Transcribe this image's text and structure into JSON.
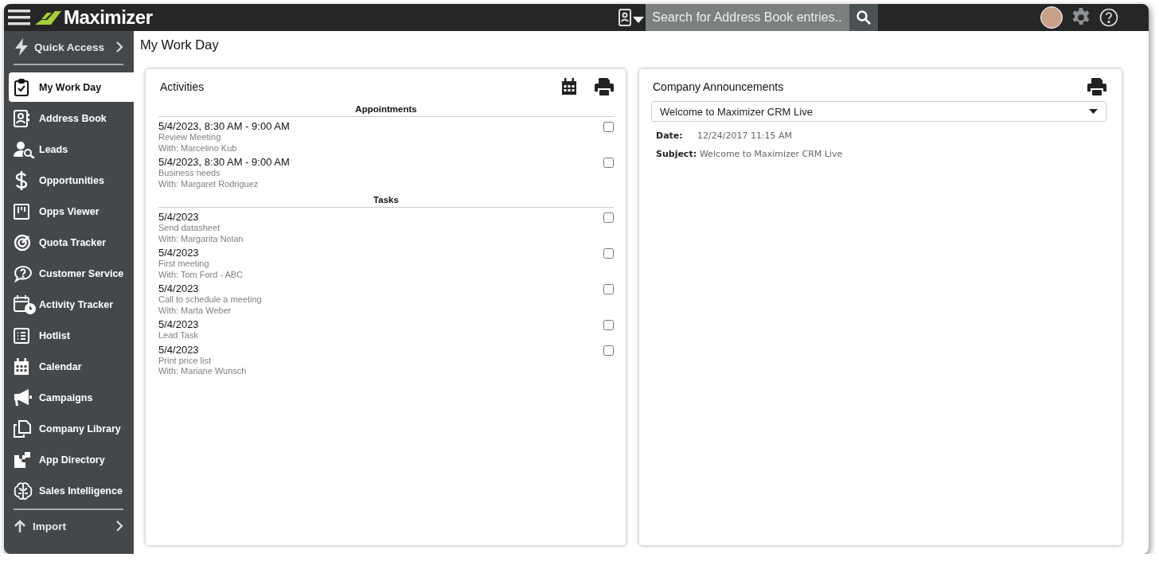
{
  "topbar": {
    "brand": "Maximizer",
    "search": {
      "placeholder": "Search for Address Book entries..."
    }
  },
  "sidebar": {
    "quick_access": "Quick Access",
    "items": [
      {
        "label": "My Work Day",
        "selected": true
      },
      {
        "label": "Address Book",
        "selected": false
      },
      {
        "label": "Leads",
        "selected": false
      },
      {
        "label": "Opportunities",
        "selected": false
      },
      {
        "label": "Opps Viewer",
        "selected": false
      },
      {
        "label": "Quota Tracker",
        "selected": false
      },
      {
        "label": "Customer Service",
        "selected": false
      },
      {
        "label": "Activity Tracker",
        "selected": false
      },
      {
        "label": "Hotlist",
        "selected": false
      },
      {
        "label": "Calendar",
        "selected": false
      },
      {
        "label": "Campaigns",
        "selected": false
      },
      {
        "label": "Company Library",
        "selected": false
      },
      {
        "label": "App Directory",
        "selected": false
      },
      {
        "label": "Sales Intelligence",
        "selected": false
      }
    ],
    "footer_item": "Import"
  },
  "page_title": "My Work Day",
  "activities": {
    "title": "Activities",
    "sections": [
      {
        "heading": "Appointments",
        "items": [
          {
            "when": "5/4/2023, 8:30 AM - 9:00 AM",
            "subject": "Review Meeting",
            "with": "With: Marcelino Kub",
            "checked": false
          },
          {
            "when": "5/4/2023, 8:30 AM - 9:00 AM",
            "subject": "Business needs",
            "with": "With: Margaret Rodriguez",
            "checked": false
          }
        ]
      },
      {
        "heading": "Tasks",
        "items": [
          {
            "when": "5/4/2023",
            "subject": "Send datasheet",
            "with": "With: Margarita Nolan",
            "checked": false
          },
          {
            "when": "5/4/2023",
            "subject": "First meeting",
            "with": "With: Tom Ford - ABC",
            "checked": false
          },
          {
            "when": "5/4/2023",
            "subject": "Call to schedule a meeting",
            "with": "With: Marta Weber",
            "checked": false
          },
          {
            "when": "5/4/2023",
            "subject": "Lead Task",
            "checked": false
          },
          {
            "when": "5/4/2023",
            "subject": "Print price list",
            "with": "With: Mariane Wunsch",
            "checked": false
          }
        ]
      }
    ]
  },
  "announcements": {
    "title": "Company Announcements",
    "selected": "Welcome to Maximizer CRM Live",
    "date_label": "Date:",
    "date": "12/24/2017 11:15 AM",
    "subject_label": "Subject:",
    "subject": "Welcome to Maximizer CRM Live"
  }
}
